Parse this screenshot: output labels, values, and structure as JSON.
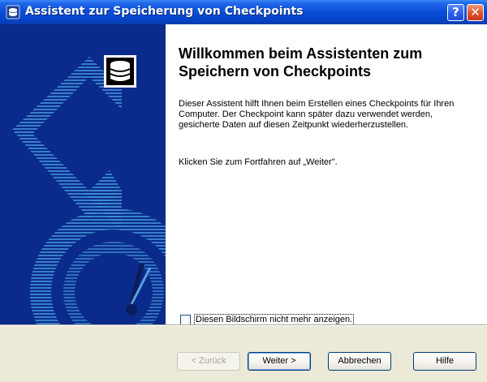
{
  "window": {
    "title": "Assistent zur Speicherung von Checkpoints",
    "help_glyph": "?",
    "close_glyph": "✕"
  },
  "icons": {
    "title_icon": "database-icon",
    "panel_icon": "database-stack-icon",
    "help_button": "help-icon",
    "close_button": "close-icon"
  },
  "content": {
    "heading_line1": "Willkommen beim Assistenten zum",
    "heading_line2": "Speichern von Checkpoints",
    "paragraph1": "Dieser Assistent hilft Ihnen beim Erstellen eines Checkpoints für Ihren Computer. Der Checkpoint kann später dazu verwendet werden, gesicherte Daten auf diesen Zeitpunkt wiederherzustellen.",
    "paragraph2": "Klicken Sie zum Fortfahren auf „Weiter\".",
    "checkbox_label": "Diesen Bildschirm nicht mehr anzeigen.",
    "checkbox_checked": false
  },
  "buttons": {
    "back": "< Zurück",
    "next": "Weiter >",
    "cancel": "Abbrechen",
    "help": "Hilfe"
  },
  "colors": {
    "titlebar": "#0a4fd9",
    "side_panel": "#0b2b8c",
    "side_art": "#3f8fd2"
  }
}
